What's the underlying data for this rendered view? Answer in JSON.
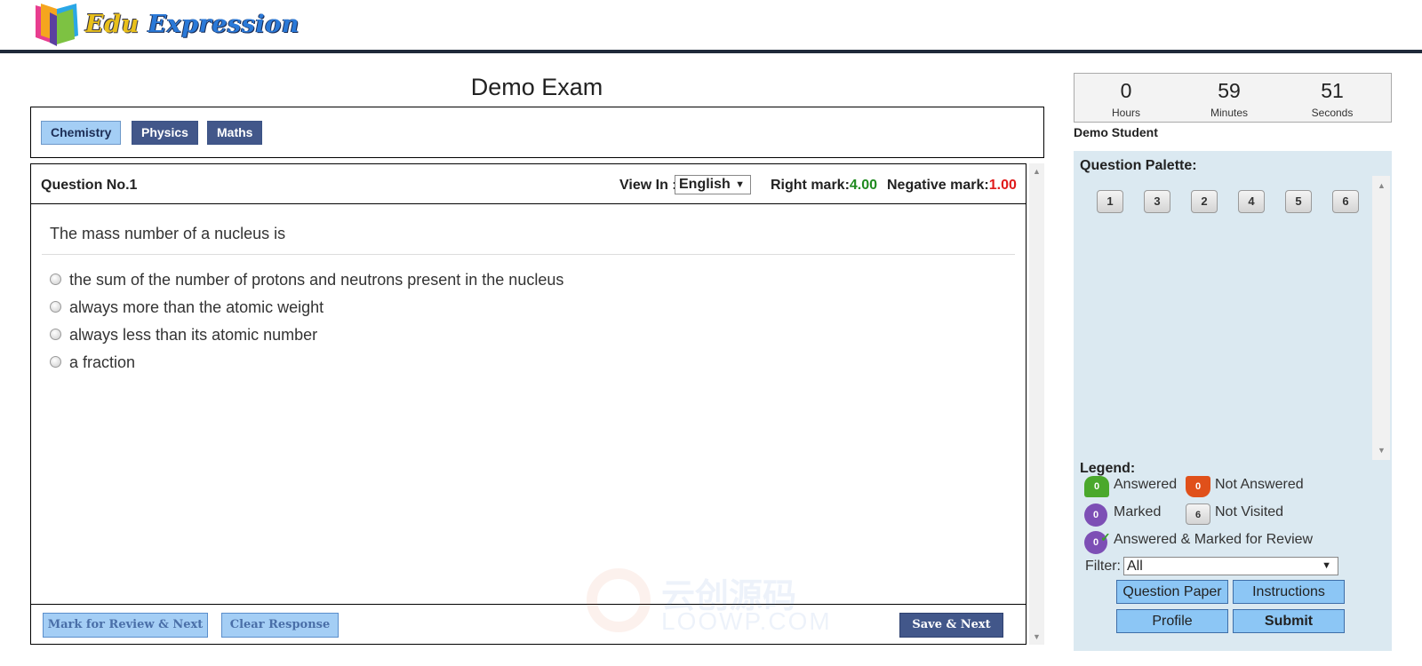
{
  "header": {
    "logo_word1": "Edu",
    "logo_word2": "Expression"
  },
  "exam": {
    "title": "Demo Exam",
    "subjects": [
      {
        "label": "Chemistry",
        "active": true
      },
      {
        "label": "Physics",
        "active": false
      },
      {
        "label": "Maths",
        "active": false
      }
    ]
  },
  "question": {
    "number_label": "Question No.1",
    "view_in_label": "View In :",
    "language": "English",
    "right_mark_label": "Right mark:",
    "right_mark_value": "4.00",
    "negative_mark_label": "Negative mark:",
    "negative_mark_value": "1.00",
    "text": "The mass number of a nucleus is",
    "options": [
      "the sum of the number of protons and neutrons present in the nucleus",
      "always more than the atomic weight",
      "always less than its atomic number",
      "a fraction"
    ]
  },
  "footer": {
    "mark_review_label": "Mark for Review & Next",
    "clear_label": "Clear Response",
    "save_label": "Save & Next"
  },
  "timer": {
    "hours": "0",
    "hours_label": "Hours",
    "minutes": "59",
    "minutes_label": "Minutes",
    "seconds": "51",
    "seconds_label": "Seconds"
  },
  "student": {
    "name": "Demo Student"
  },
  "palette": {
    "title": "Question Palette:",
    "buttons": [
      "1",
      "3",
      "2",
      "4",
      "5",
      "6"
    ]
  },
  "legend": {
    "title": "Legend:",
    "answered_count": "0",
    "answered_label": "Answered",
    "not_answered_count": "0",
    "not_answered_label": "Not Answered",
    "marked_count": "0",
    "marked_label": "Marked",
    "not_visited_count": "6",
    "not_visited_label": "Not Visited",
    "answered_marked_count": "0",
    "answered_marked_label": "Answered & Marked for Review",
    "colors": {
      "answered": "#4aa82c",
      "not_answered": "#e0501a",
      "marked": "#7d4fb5"
    }
  },
  "filter": {
    "label": "Filter:",
    "value": "All"
  },
  "actions": {
    "question_paper": "Question Paper",
    "instructions": "Instructions",
    "profile": "Profile",
    "submit": "Submit"
  },
  "watermark": {
    "line1": "云创源码",
    "line2": "LOOWP.COM"
  }
}
